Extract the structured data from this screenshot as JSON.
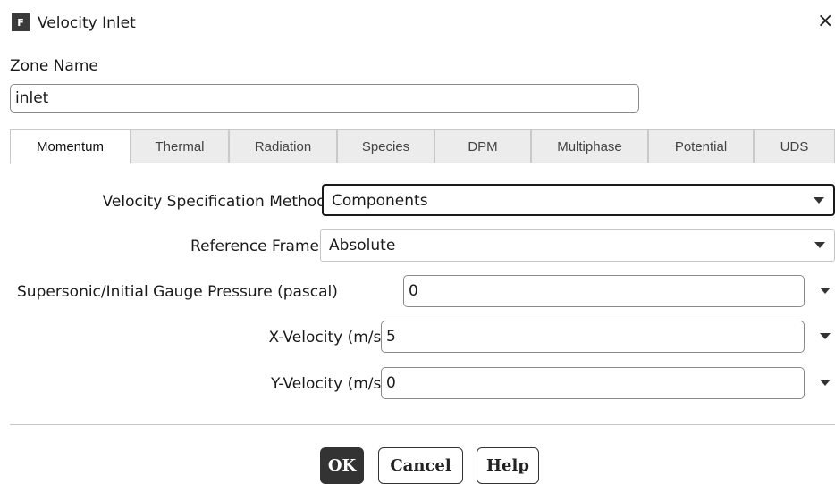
{
  "window": {
    "icon_letter": "F",
    "title": "Velocity Inlet",
    "close_glyph": "×"
  },
  "zone": {
    "label": "Zone Name",
    "value": "inlet"
  },
  "tabs": [
    {
      "label": "Momentum",
      "active": true
    },
    {
      "label": "Thermal",
      "active": false
    },
    {
      "label": "Radiation",
      "active": false
    },
    {
      "label": "Species",
      "active": false
    },
    {
      "label": "DPM",
      "active": false
    },
    {
      "label": "Multiphase",
      "active": false
    },
    {
      "label": "Potential",
      "active": false
    },
    {
      "label": "UDS",
      "active": false
    }
  ],
  "momentum": {
    "velocity_method": {
      "label": "Velocity Specification Method",
      "value": "Components"
    },
    "reference_frame": {
      "label": "Reference Frame",
      "value": "Absolute"
    },
    "gauge_pressure": {
      "label": "Supersonic/Initial Gauge Pressure (pascal)",
      "value": "0"
    },
    "x_velocity": {
      "label": "X-Velocity (m/s)",
      "value": "5"
    },
    "y_velocity": {
      "label": "Y-Velocity (m/s)",
      "value": "0"
    }
  },
  "buttons": {
    "ok": "OK",
    "cancel": "Cancel",
    "help": "Help"
  },
  "colors": {
    "primary_button": "#333333",
    "tab_inactive_bg": "#ececec"
  }
}
